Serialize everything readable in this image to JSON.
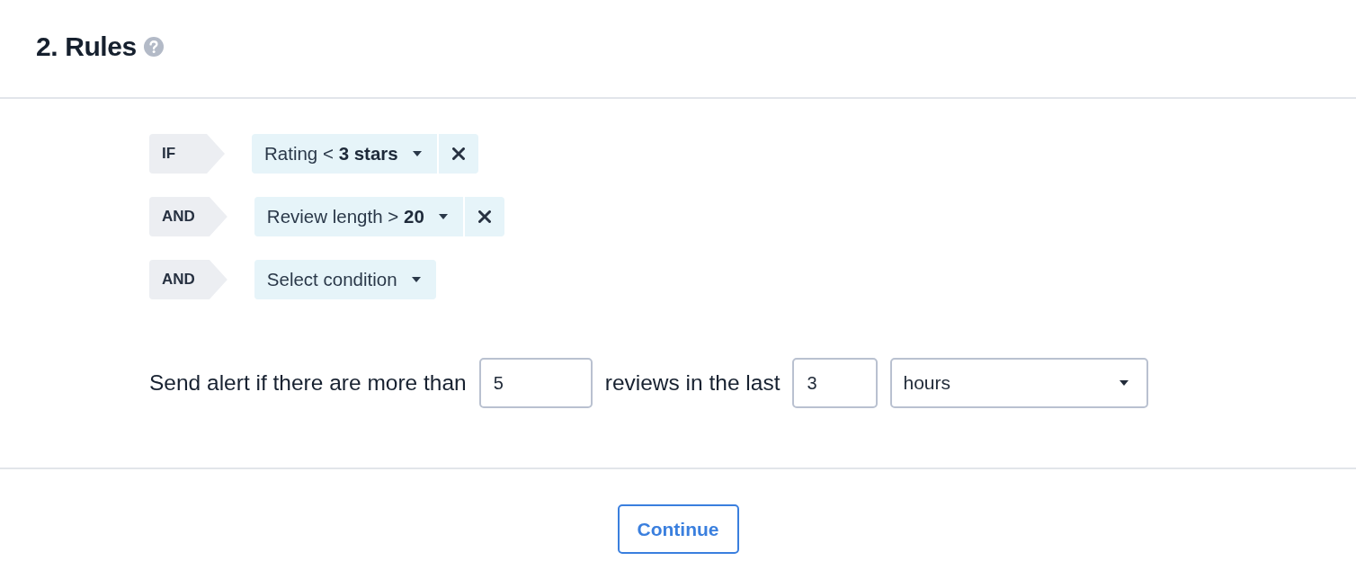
{
  "section": {
    "title": "2. Rules"
  },
  "rules": [
    {
      "operator": "IF",
      "condition": "Rating < **3 stars**",
      "removable": true
    },
    {
      "operator": "AND",
      "condition": "Review length > **20**",
      "removable": true
    },
    {
      "operator": "AND",
      "condition": "Select condition",
      "removable": false
    }
  ],
  "alert": {
    "items": [
      {
        "kind": "text",
        "text": "Send alert if there are more than"
      },
      {
        "kind": "input",
        "value": "5"
      },
      {
        "kind": "text",
        "text": "reviews in the last"
      },
      {
        "kind": "input",
        "value": "3"
      },
      {
        "kind": "select",
        "value": "hours"
      }
    ]
  },
  "footer": {
    "button": "Continue"
  }
}
